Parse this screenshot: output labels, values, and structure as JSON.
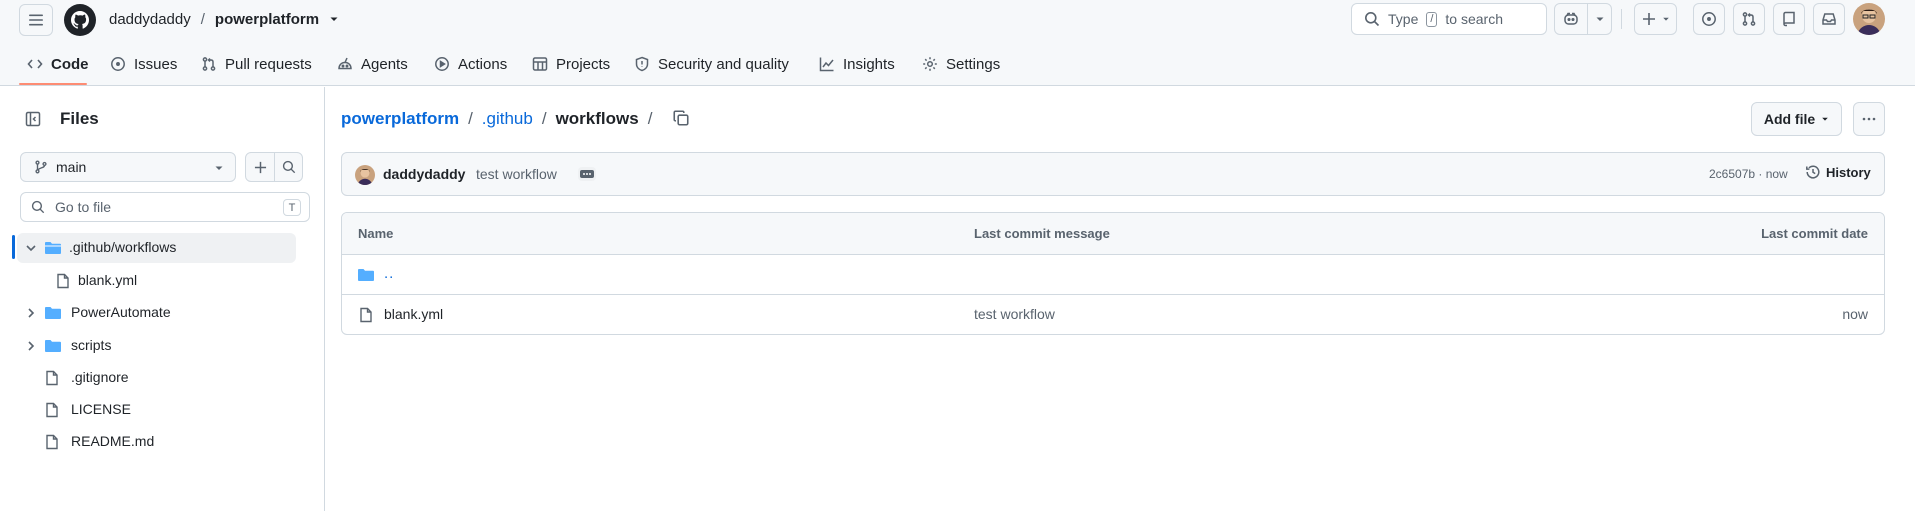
{
  "header": {
    "owner": "daddydaddy",
    "separator": "/",
    "repo": "powerplatform",
    "search": {
      "prefix": "Type",
      "key": "/",
      "suffix": "to search"
    }
  },
  "nav": {
    "tabs": [
      {
        "label": "Code",
        "icon": "code-icon",
        "active": true
      },
      {
        "label": "Issues",
        "icon": "issue-icon"
      },
      {
        "label": "Pull requests",
        "icon": "pull-request-icon"
      },
      {
        "label": "Agents",
        "icon": "agents-icon"
      },
      {
        "label": "Actions",
        "icon": "actions-icon"
      },
      {
        "label": "Projects",
        "icon": "projects-icon"
      },
      {
        "label": "Security and quality",
        "icon": "shield-icon"
      },
      {
        "label": "Insights",
        "icon": "graph-icon"
      },
      {
        "label": "Settings",
        "icon": "gear-icon"
      }
    ]
  },
  "sidebar": {
    "title": "Files",
    "branch": "main",
    "goto_placeholder": "Go to file",
    "goto_shortcut": "T",
    "tree": [
      {
        "label": ".github/workflows",
        "type": "folder",
        "expanded": true,
        "selected": true
      },
      {
        "label": "blank.yml",
        "type": "file"
      },
      {
        "label": "PowerAutomate",
        "type": "folder",
        "expanded": false
      },
      {
        "label": "scripts",
        "type": "folder",
        "expanded": false
      },
      {
        "label": ".gitignore",
        "type": "file"
      },
      {
        "label": "LICENSE",
        "type": "file"
      },
      {
        "label": "README.md",
        "type": "file"
      }
    ]
  },
  "breadcrumb": {
    "root": "powerplatform",
    "sep": "/",
    "mid": ".github",
    "current": "workflows"
  },
  "actions": {
    "add_file": "Add file"
  },
  "commit": {
    "author": "daddydaddy",
    "message": "test workflow",
    "sha_time": "2c6507b · now",
    "history": "History"
  },
  "table": {
    "headers": {
      "name": "Name",
      "message": "Last commit message",
      "date": "Last commit date"
    },
    "parent": "..",
    "rows": [
      {
        "name": "blank.yml",
        "message": "test workflow",
        "date": "now"
      }
    ]
  },
  "colors": {
    "accent": "#0969da",
    "folder": "#54aeff",
    "tab_underline": "#fd8c73",
    "selected_bar": "#0969da"
  }
}
